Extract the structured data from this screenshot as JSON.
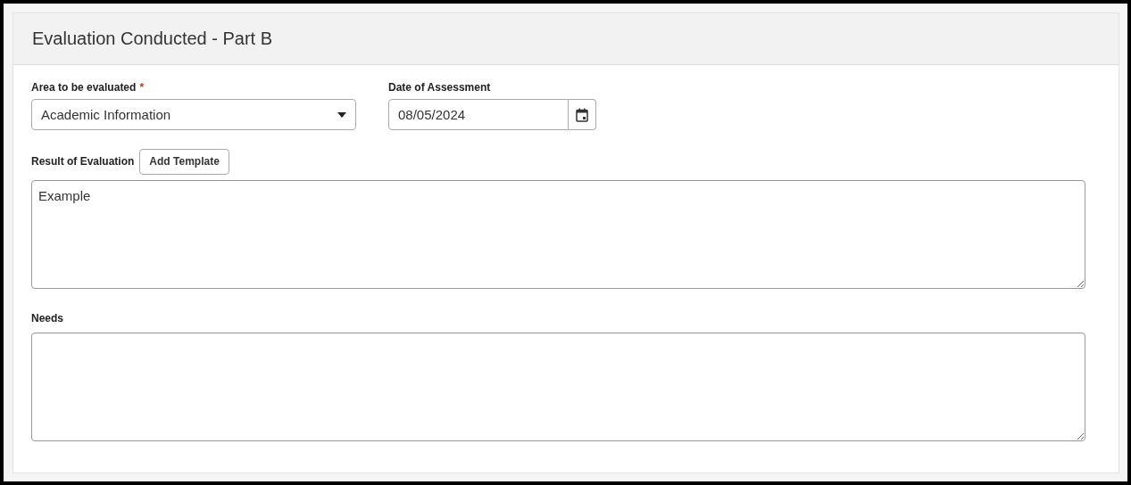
{
  "panel": {
    "title": "Evaluation Conducted - Part B"
  },
  "area_field": {
    "label": "Area to be evaluated",
    "required_mark": "*",
    "value": "Academic Information"
  },
  "date_field": {
    "label": "Date of Assessment",
    "value": "08/05/2024"
  },
  "result_field": {
    "label": "Result of Evaluation",
    "button": "Add Template",
    "value": "Example"
  },
  "needs_field": {
    "label": "Needs"
  }
}
